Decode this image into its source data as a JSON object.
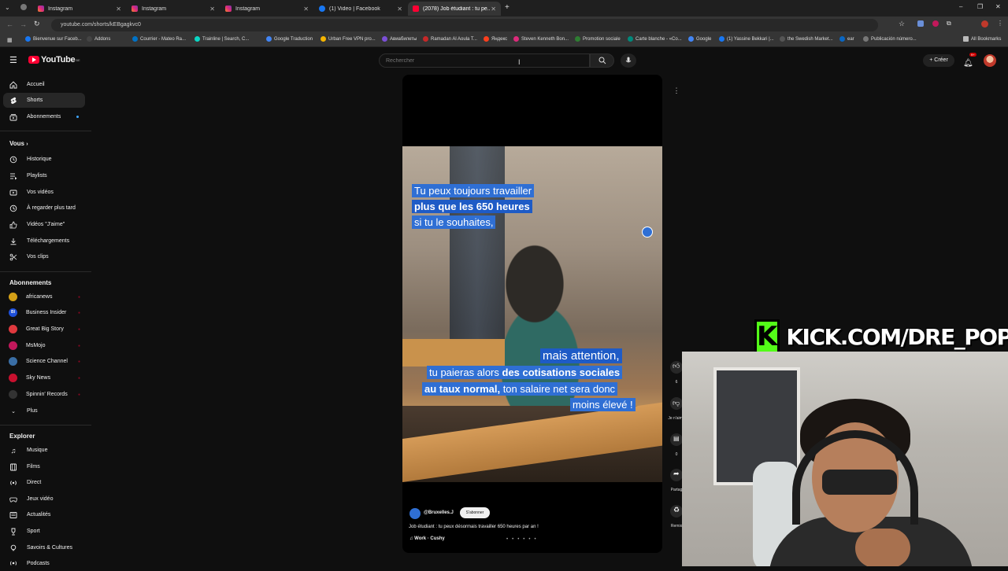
{
  "browser": {
    "tabs": [
      {
        "label": "Instagram",
        "icon": "instagram-icon",
        "active": false
      },
      {
        "label": "Instagram",
        "icon": "instagram-icon",
        "active": false
      },
      {
        "label": "Instagram",
        "icon": "instagram-icon",
        "active": false
      },
      {
        "label": "(1) Video | Facebook",
        "icon": "facebook-icon",
        "active": false
      },
      {
        "label": "(2078) Job étudiant : tu pe...",
        "icon": "youtube-icon",
        "active": true
      }
    ],
    "url": "youtube.com/shorts/kEBgagkvc0",
    "bookmarks": [
      "Bienvenue sur Faceb...",
      "Addons",
      "Courrier - Mateo Ra...",
      "Trainline | Search, C...",
      "Google Traduction",
      "Urban Free VPN pro...",
      "Авиабилеты",
      "Ramadan Al Aoula T...",
      "Яндекс",
      "Steven Kenneth Bon...",
      "Promotion sociale",
      "Carte blanche - «Co...",
      "Google",
      "(1) Yassine Bekkari |...",
      "the Swedish Market...",
      "ear",
      "Publicación número...",
      "All Bookmarks"
    ]
  },
  "youtube": {
    "logo": "YouTube",
    "region": "BE",
    "search_placeholder": "Rechercher",
    "create_label": "Créer",
    "notif_count": "9+"
  },
  "sidebar": {
    "main": [
      {
        "label": "Accueil",
        "icon": "home-icon"
      },
      {
        "label": "Shorts",
        "icon": "shorts-icon"
      },
      {
        "label": "Abonnements",
        "icon": "subscriptions-icon"
      }
    ],
    "you_header": "Vous",
    "you": [
      {
        "label": "Historique",
        "icon": "history-icon"
      },
      {
        "label": "Playlists",
        "icon": "playlists-icon"
      },
      {
        "label": "Vos vidéos",
        "icon": "your-videos-icon"
      },
      {
        "label": "À regarder plus tard",
        "icon": "watch-later-icon"
      },
      {
        "label": "Vidéos \"J'aime\"",
        "icon": "liked-icon"
      },
      {
        "label": "Téléchargements",
        "icon": "download-icon"
      },
      {
        "label": "Vos clips",
        "icon": "clips-icon"
      }
    ],
    "subs_header": "Abonnements",
    "subs": [
      {
        "label": "africanews",
        "color": "#d4a017"
      },
      {
        "label": "Business Insider",
        "color": "#1e4fd8"
      },
      {
        "label": "Great Big Story",
        "color": "#e0393e"
      },
      {
        "label": "MsMojo",
        "color": "#c2185b"
      },
      {
        "label": "Science Channel",
        "color": "#3a6ea5"
      },
      {
        "label": "Sky News",
        "color": "#c8102e"
      },
      {
        "label": "Spinnin' Records",
        "color": "#333333"
      },
      {
        "label": "Plus",
        "color": ""
      }
    ],
    "explore_header": "Explorer",
    "explore": [
      {
        "label": "Musique",
        "icon": "music-icon"
      },
      {
        "label": "Films",
        "icon": "film-icon"
      },
      {
        "label": "Direct",
        "icon": "live-icon"
      },
      {
        "label": "Jeux vidéo",
        "icon": "gaming-icon"
      },
      {
        "label": "Actualités",
        "icon": "news-icon"
      },
      {
        "label": "Sport",
        "icon": "trophy-icon"
      },
      {
        "label": "Savoirs & Cultures",
        "icon": "learning-icon"
      },
      {
        "label": "Podcasts",
        "icon": "podcast-icon"
      }
    ]
  },
  "short": {
    "captions": {
      "line1": "Tu peux toujours travailler",
      "line2": "plus que les 650 heures",
      "line3": "si tu le souhaites,",
      "line4": "mais attention,",
      "line5a": "tu paieras alors ",
      "line5b": "des cotisations sociales",
      "line6a": "au taux normal,",
      "line6b": " ton salaire net sera donc",
      "line7": "moins élevé !"
    },
    "channel": "@Bruxelles.J",
    "subscribe_label": "S'abonner",
    "title": "Job étudiant : tu peux désormais travailler 650 heures par an !",
    "music": "♫ Work · Cushy",
    "actions": {
      "likes": "6",
      "dislike_label": "Je n'aime",
      "comments": "0",
      "share_label": "Partag",
      "remix_label": "Remix"
    }
  },
  "overlay": {
    "kick_text": "KICK.COM/DRE_POP",
    "kick_letter": "K",
    "kick_color": "#53fc18"
  }
}
